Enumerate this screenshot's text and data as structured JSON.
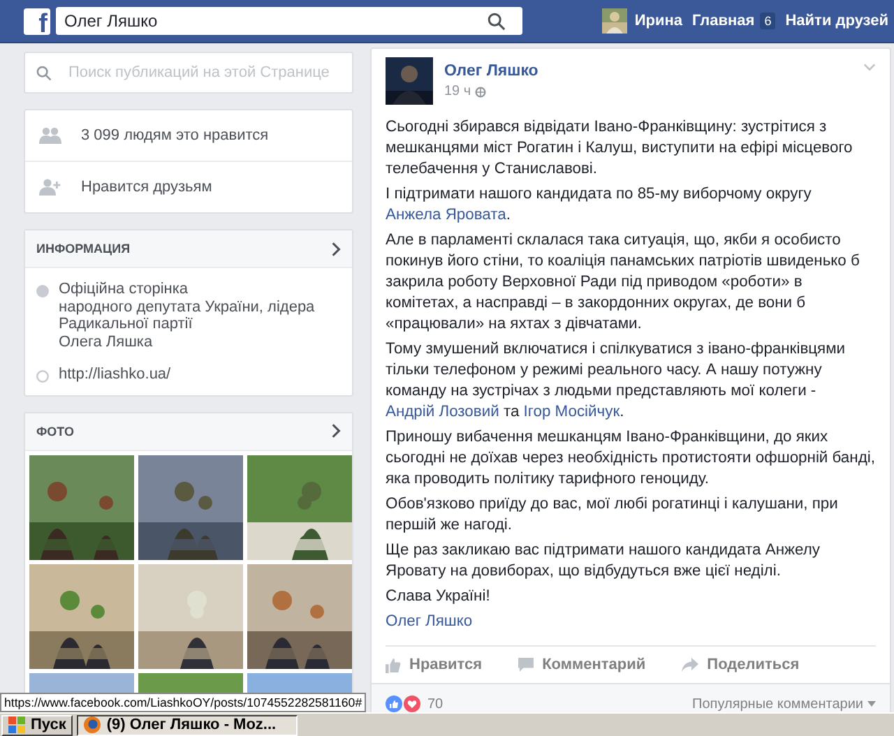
{
  "topbar": {
    "logo": "f",
    "search_value": "Олег Ляшко",
    "user_name": "Ирина",
    "home_label": "Главная",
    "home_badge": "6",
    "find_friends": "Найти друзей"
  },
  "page_search": {
    "placeholder": "Поиск публикаций на этой Странице"
  },
  "likes": [
    {
      "kind": "people",
      "text": "3 099 людям это нравится"
    },
    {
      "kind": "friends",
      "text": "Нравится друзьям"
    }
  ],
  "info": {
    "title": "ИНФОРМАЦИЯ",
    "description_lines": [
      "Офіційна сторінка",
      "народного депутата України, лідера",
      "Радикальної партії",
      "Олега Ляшка"
    ],
    "website": "http://liashko.ua/"
  },
  "photos": {
    "title": "ФОТО"
  },
  "post": {
    "author": "Олег Ляшко",
    "time": "19 ч",
    "paragraphs": [
      [
        {
          "text": "Сьогодні збирався відвідати Івано-Франківщину: зустрітися з мешканцями міст Рогатин і Калуш, виступити на ефірі місцевого телебачення у Станиславові.",
          "link": false
        }
      ],
      [
        {
          "text": "І підтримати нашого кандидата по 85-му виборчому округу ",
          "link": false
        },
        {
          "text": "Анжела Яровата",
          "link": true
        },
        {
          "text": ".",
          "link": false
        }
      ],
      [
        {
          "text": "Але в парламенті склалася така ситуація, що, якби я особисто покинув його стіни, то коаліція панамських патріотів швиденько б закрила роботу Верховної Ради під приводом «роботи» в комітетах, а насправді – в закордонних округах, де вони б «працювали» на яхтах з дівчатами.",
          "link": false
        }
      ],
      [
        {
          "text": "Тому змушений включатися і спілкуватися з івано-франківцями тільки телефоном у режимі реального часу. А нашу потужну команду на зустрічах з людьми представляють мої колеги - ",
          "link": false
        },
        {
          "text": "Андрій Лозовий",
          "link": true
        },
        {
          "text": " та ",
          "link": false
        },
        {
          "text": "Ігор Мосійчук",
          "link": true
        },
        {
          "text": ".",
          "link": false
        }
      ],
      [
        {
          "text": "Приношу вибачення мешканцям Івано-Франківщини, до яких сьогодні не доїхав через необхідність протистояти офшорній банді, яка проводить політику тарифного геноциду.",
          "link": false
        }
      ],
      [
        {
          "text": "Обов'язково приїду до вас, мої любі рогатинці і калушани, при першій же нагоді.",
          "link": false
        }
      ],
      [
        {
          "text": "Ще раз закликаю вас підтримати нашого кандидата Анжелу Яровату на довиборах, що відбудуться вже цієї неділі.",
          "link": false
        }
      ],
      [
        {
          "text": "Слава Україні!",
          "link": false
        }
      ],
      [
        {
          "text": "Олег Ляшко",
          "link": true
        }
      ]
    ],
    "actions": [
      {
        "kind": "like",
        "label": "Нравится"
      },
      {
        "kind": "comment",
        "label": "Комментарий"
      },
      {
        "kind": "share",
        "label": "Поделиться"
      }
    ],
    "reactions_count": "70",
    "sort_label": "Популярные комментарии"
  },
  "status_bar": {
    "url": "https://www.facebook.com/LiashkoOY/posts/1074552282581160#"
  },
  "taskbar": {
    "start": "Пуск",
    "window": "(9) Олег Ляшко - Moz..."
  }
}
